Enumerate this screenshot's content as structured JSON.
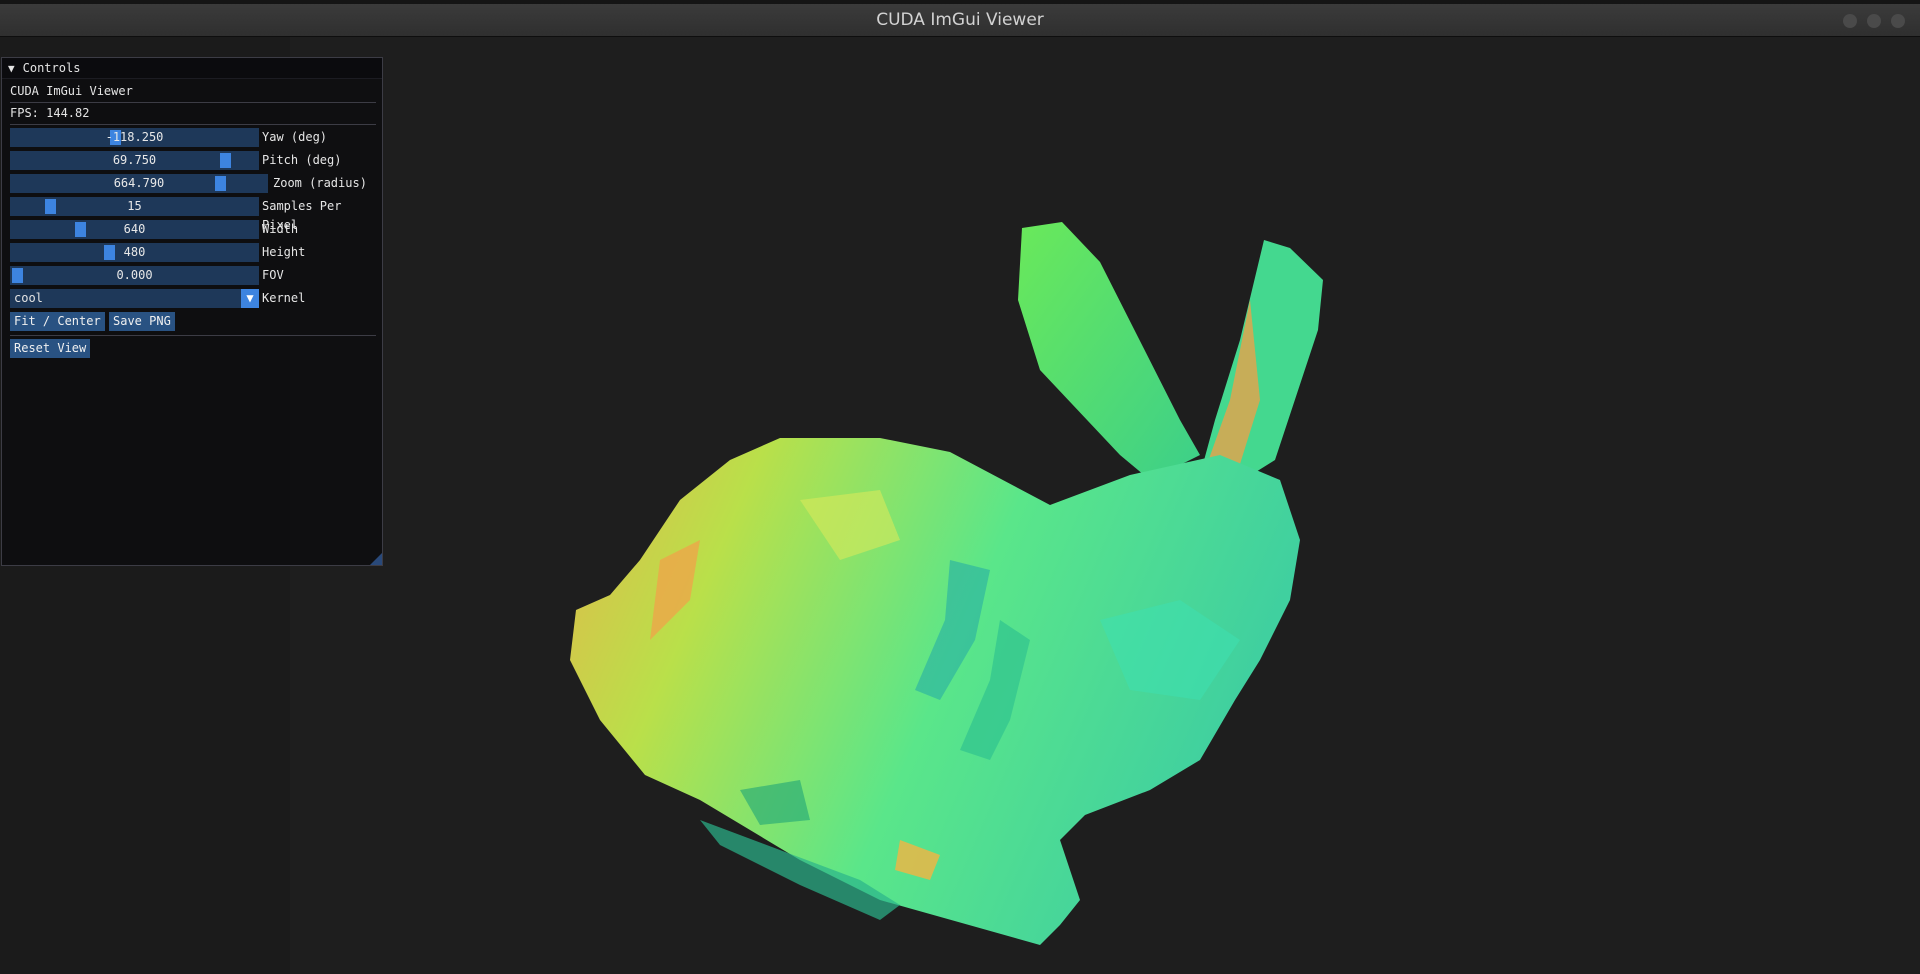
{
  "window": {
    "title": "CUDA ImGui Viewer"
  },
  "panel": {
    "header": "Controls",
    "app_name": "CUDA ImGui Viewer",
    "fps": "FPS: 144.82",
    "sliders": [
      {
        "value": "-118.250",
        "label": "Yaw (deg)",
        "fraction": 0.42
      },
      {
        "value": "69.750",
        "label": "Pitch (deg)",
        "fraction": 0.87
      },
      {
        "value": "664.790",
        "label": "Zoom (radius)",
        "fraction": 0.78
      },
      {
        "value": "15",
        "label": "Samples Per Pixel",
        "fraction": 0.15
      },
      {
        "value": "640",
        "label": "Width",
        "fraction": 0.27
      },
      {
        "value": "480",
        "label": "Height",
        "fraction": 0.4
      },
      {
        "value": "0.000",
        "label": "FOV",
        "fraction": 0.0
      }
    ],
    "kernel": {
      "value": "cool",
      "label": "Kernel"
    },
    "buttons": {
      "fit_center": "Fit / Center",
      "save_png": "Save PNG",
      "reset_view": "Reset View"
    }
  },
  "colors": {
    "accent": "#3d84e0",
    "frame_bg": "#1e3859",
    "button": "#295282"
  },
  "icons": {
    "collapse": "triangle-down-icon",
    "combo": "chevron-down-icon"
  }
}
